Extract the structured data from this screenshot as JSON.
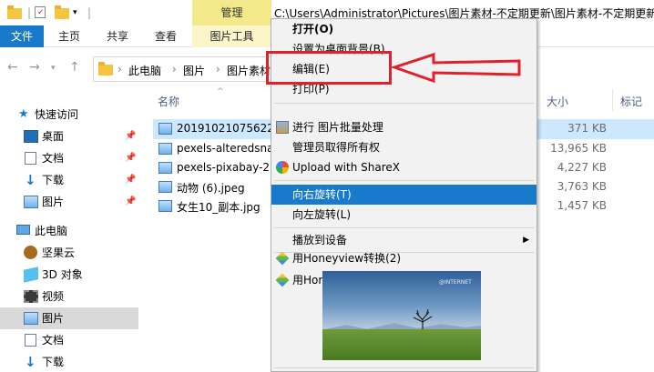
{
  "titlebar": {
    "manage_tab": "管理",
    "path": "C:\\Users\\Administrator\\Pictures\\图片素材-不定期更新\\图片素材-不定期更新"
  },
  "ribbon": {
    "tabs": [
      "文件",
      "主页",
      "共享",
      "查看",
      "图片工具"
    ]
  },
  "address": {
    "crumbs": [
      "此电脑",
      "图片",
      "图片素材"
    ]
  },
  "nav": {
    "quick_access": "快速访问",
    "items": [
      {
        "label": "桌面",
        "pinned": true
      },
      {
        "label": "文档",
        "pinned": true
      },
      {
        "label": "下载",
        "pinned": true
      },
      {
        "label": "图片",
        "pinned": true
      }
    ],
    "this_pc": "此电脑",
    "pc_items": [
      "坚果云",
      "3D 对象",
      "视频",
      "图片",
      "文档",
      "下载"
    ]
  },
  "filelist": {
    "col_name": "名称",
    "col_size": "大小",
    "col_tag": "标记",
    "files": [
      {
        "name": "20191021075622",
        "size": "371 KB",
        "selected": true
      },
      {
        "name": "pexels-alteredsna",
        "size": "13,965 KB",
        "selected": false
      },
      {
        "name": "pexels-pixabay-2...",
        "size": "4,227 KB",
        "selected": false
      },
      {
        "name": "动物 (6).jpeg",
        "size": "3,763 KB",
        "selected": false
      },
      {
        "name": "女生10_副本.jpg",
        "size": "1,457 KB",
        "selected": false
      }
    ]
  },
  "context_menu": {
    "items": [
      {
        "label": "打开(O)",
        "bold": true
      },
      {
        "label": "设置为桌面背景(B)"
      },
      {
        "label": "编辑(E)"
      },
      {
        "label": "打印(P)"
      },
      {
        "label": "进行 图片批量处理"
      },
      {
        "label": "管理员取得所有权"
      },
      {
        "label": "Upload with ShareX"
      },
      {
        "label": "向右旋转(T)",
        "highlight": true
      },
      {
        "label": "向左旋转(L)"
      },
      {
        "label": "播放到设备"
      },
      {
        "label": "用Honeyview转换(2)"
      },
      {
        "label": "用Honeyview浏览(3)"
      }
    ],
    "thumbnail_watermark": "@INTERNET"
  },
  "colors": {
    "file_tab": "#1979ca",
    "manage_tab": "#f3e98a",
    "selection": "#cce8ff",
    "menu_highlight": "#1979ca",
    "annotation": "#e0202a"
  }
}
